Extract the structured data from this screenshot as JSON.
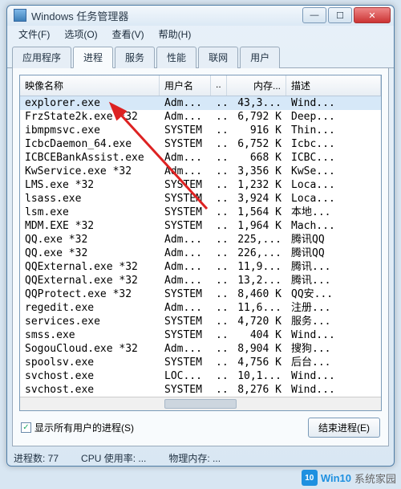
{
  "window": {
    "title": "Windows 任务管理器"
  },
  "menu": {
    "file": "文件(F)",
    "options": "选项(O)",
    "view": "查看(V)",
    "help": "帮助(H)"
  },
  "tabs": {
    "apps": "应用程序",
    "processes": "进程",
    "services": "服务",
    "performance": "性能",
    "networking": "联网",
    "users": "用户"
  },
  "columns": {
    "image_name": "映像名称",
    "user_name": "用户名",
    "cpu": "..",
    "memory": "内存...",
    "description": "描述"
  },
  "rows": [
    {
      "name": "explorer.exe",
      "user": "Adm...",
      "cpu": "..",
      "mem": "43,3...",
      "desc": "Wind...",
      "sel": true
    },
    {
      "name": "FrzState2k.exe *32",
      "user": "Adm...",
      "cpu": "..",
      "mem": "6,792 K",
      "desc": "Deep..."
    },
    {
      "name": "ibmpmsvc.exe",
      "user": "SYSTEM",
      "cpu": "..",
      "mem": "916 K",
      "desc": "Thin..."
    },
    {
      "name": "IcbcDaemon_64.exe",
      "user": "SYSTEM",
      "cpu": "..",
      "mem": "6,752 K",
      "desc": "Icbc..."
    },
    {
      "name": "ICBCEBankAssist.exe",
      "user": "Adm...",
      "cpu": "..",
      "mem": "668 K",
      "desc": "ICBC..."
    },
    {
      "name": "KwService.exe *32",
      "user": "Adm...",
      "cpu": "..",
      "mem": "3,356 K",
      "desc": "KwSe..."
    },
    {
      "name": "LMS.exe *32",
      "user": "SYSTEM",
      "cpu": "..",
      "mem": "1,232 K",
      "desc": "Loca..."
    },
    {
      "name": "lsass.exe",
      "user": "SYSTEM",
      "cpu": "..",
      "mem": "3,924 K",
      "desc": "Loca..."
    },
    {
      "name": "lsm.exe",
      "user": "SYSTEM",
      "cpu": "..",
      "mem": "1,564 K",
      "desc": "本地..."
    },
    {
      "name": "MDM.EXE *32",
      "user": "SYSTEM",
      "cpu": "..",
      "mem": "1,964 K",
      "desc": "Mach..."
    },
    {
      "name": "QQ.exe *32",
      "user": "Adm...",
      "cpu": "..",
      "mem": "225,...",
      "desc": "腾讯QQ"
    },
    {
      "name": "QQ.exe *32",
      "user": "Adm...",
      "cpu": "..",
      "mem": "226,...",
      "desc": "腾讯QQ"
    },
    {
      "name": "QQExternal.exe *32",
      "user": "Adm...",
      "cpu": "..",
      "mem": "11,9...",
      "desc": "腾讯..."
    },
    {
      "name": "QQExternal.exe *32",
      "user": "Adm...",
      "cpu": "..",
      "mem": "13,2...",
      "desc": "腾讯..."
    },
    {
      "name": "QQProtect.exe *32",
      "user": "SYSTEM",
      "cpu": "..",
      "mem": "8,460 K",
      "desc": "QQ安..."
    },
    {
      "name": "regedit.exe",
      "user": "Adm...",
      "cpu": "..",
      "mem": "11,6...",
      "desc": "注册..."
    },
    {
      "name": "services.exe",
      "user": "SYSTEM",
      "cpu": "..",
      "mem": "4,720 K",
      "desc": "服务..."
    },
    {
      "name": "smss.exe",
      "user": "SYSTEM",
      "cpu": "..",
      "mem": "404 K",
      "desc": "Wind..."
    },
    {
      "name": "SogouCloud.exe *32",
      "user": "Adm...",
      "cpu": "..",
      "mem": "8,904 K",
      "desc": "搜狗..."
    },
    {
      "name": "spoolsv.exe",
      "user": "SYSTEM",
      "cpu": "..",
      "mem": "4,756 K",
      "desc": "后台..."
    },
    {
      "name": "svchost.exe",
      "user": "LOC...",
      "cpu": "..",
      "mem": "10,1...",
      "desc": "Wind..."
    },
    {
      "name": "svchost.exe",
      "user": "SYSTEM",
      "cpu": "..",
      "mem": "8,276 K",
      "desc": "Wind..."
    }
  ],
  "bottom": {
    "show_all_users": "显示所有用户的进程(S)",
    "end_process": "结束进程(E)"
  },
  "status": {
    "process_count": "进程数: 77",
    "cpu_usage": "CPU 使用率: ...",
    "phys_mem": "物理内存: ..."
  },
  "watermark": {
    "logo": "10",
    "brand": "Win10",
    "site": "系统家园"
  }
}
